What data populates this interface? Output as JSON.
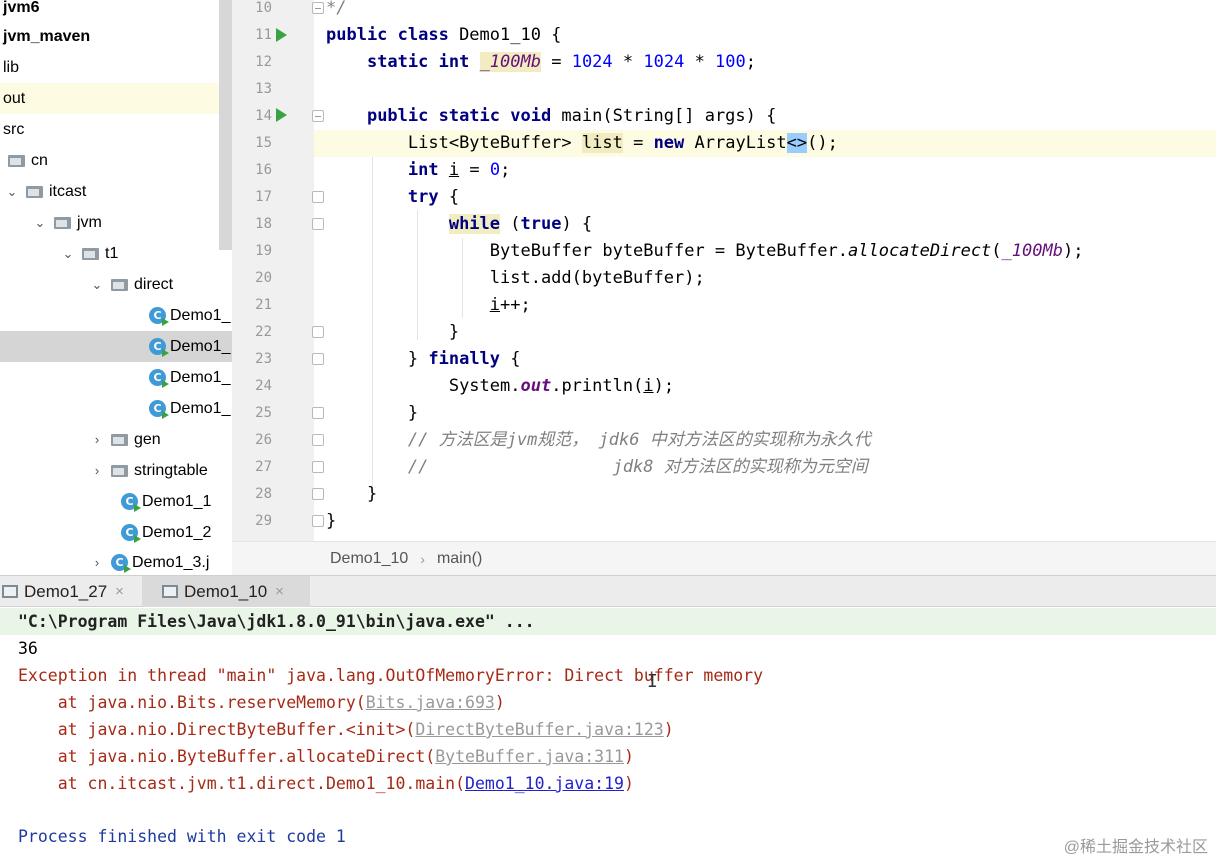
{
  "tree": {
    "items": [
      {
        "label": "jvm6"
      },
      {
        "label": "jvm_maven"
      },
      {
        "label": "lib"
      },
      {
        "label": "out"
      },
      {
        "label": "src"
      },
      {
        "label": "cn"
      },
      {
        "label": "itcast"
      },
      {
        "label": "jvm"
      },
      {
        "label": "t1"
      },
      {
        "label": "direct"
      },
      {
        "label": "Demo1_"
      },
      {
        "label": "Demo1_"
      },
      {
        "label": "Demo1_"
      },
      {
        "label": "Demo1_"
      },
      {
        "label": "gen"
      },
      {
        "label": "stringtable"
      },
      {
        "label": "Demo1_1"
      },
      {
        "label": "Demo1_2"
      },
      {
        "label": "Demo1_3.j"
      }
    ]
  },
  "editor": {
    "line_numbers": [
      "10",
      "11",
      "12",
      "13",
      "14",
      "15",
      "16",
      "17",
      "18",
      "19",
      "20",
      "21",
      "22",
      "23",
      "24",
      "25",
      "26",
      "27",
      "28",
      "29"
    ],
    "comment_top": "*/",
    "code": {
      "l11_kw": "public class",
      "l11_rest": " Demo1_10 {",
      "l12_kw": "static int",
      "l12_field": "_100Mb",
      "l12_eq": " = ",
      "l12_n1": "1024",
      "l12_mul1": " * ",
      "l12_n2": "1024",
      "l12_mul2": " * ",
      "l12_n3": "100",
      "l12_end": ";",
      "l14_kw": "public static void",
      "l14_rest": " main(String[] args) {",
      "l15_a": "List<ByteBuffer> ",
      "l15_list": "list",
      "l15_b": " = ",
      "l15_new": "new",
      "l15_c": " ArrayList",
      "l15_diamond": "<>",
      "l15_d": "();",
      "l16_kw": "int",
      "l16_sp": " ",
      "l16_i": "i",
      "l16_eq": " = ",
      "l16_zero": "0",
      "l16_end": ";",
      "l17_kw": "try",
      "l17_rest": " {",
      "l18_kw": "while",
      "l18_a": " (",
      "l18_true": "true",
      "l18_b": ") {",
      "l19_a": "ByteBuffer byteBuffer = ByteBuffer.",
      "l19_m": "allocateDirect",
      "l19_b": "(",
      "l19_f": "_100Mb",
      "l19_c": ");",
      "l20": "list.add(byteBuffer);",
      "l21_i": "i",
      "l21_rest": "++;",
      "l22": "}",
      "l23_a": "} ",
      "l23_kw": "finally",
      "l23_b": " {",
      "l24_a": "System.",
      "l24_out": "out",
      "l24_b": ".println(",
      "l24_i": "i",
      "l24_c": ");",
      "l25": "}",
      "l26": "// 方法区是jvm规范， jdk6 中对方法区的实现称为永久代",
      "l27": "//                  jdk8 对方法区的实现称为元空间",
      "l28": "}",
      "l29": "}"
    }
  },
  "breadcrumb": {
    "items": [
      "Demo1_10",
      "main()"
    ],
    "separator": "›"
  },
  "run_tabs": [
    {
      "label": "Demo1_27",
      "close": "×"
    },
    {
      "label": "Demo1_10",
      "close": "×"
    }
  ],
  "console": {
    "cmd": "\"C:\\Program Files\\Java\\jdk1.8.0_91\\bin\\java.exe\" ...",
    "out": "36",
    "exception": "Exception in thread \"main\" java.lang.OutOfMemoryError: Direct buffer memory",
    "trace": [
      {
        "prefix": "    at java.nio.Bits.reserveMemory(",
        "link": "Bits.java:693",
        "suffix": ")",
        "style": "gray"
      },
      {
        "prefix": "    at java.nio.DirectByteBuffer.<init>(",
        "link": "DirectByteBuffer.java:123",
        "suffix": ")",
        "style": "gray"
      },
      {
        "prefix": "    at java.nio.ByteBuffer.allocateDirect(",
        "link": "ByteBuffer.java:311",
        "suffix": ")",
        "style": "gray"
      },
      {
        "prefix": "    at cn.itcast.jvm.t1.direct.Demo1_10.main(",
        "link": "Demo1_10.java:19",
        "suffix": ")",
        "style": "blue"
      }
    ],
    "finished": "Process finished with exit code 1"
  },
  "text_cursor": "I",
  "watermark": "@稀土掘金技术社区",
  "colors": {
    "keyword": "#000080",
    "number": "#0000ff",
    "field": "#660e7a",
    "comment": "#808080",
    "current_line": "#fdfbe2",
    "error": "#a52a16",
    "link": "#2222cc"
  }
}
